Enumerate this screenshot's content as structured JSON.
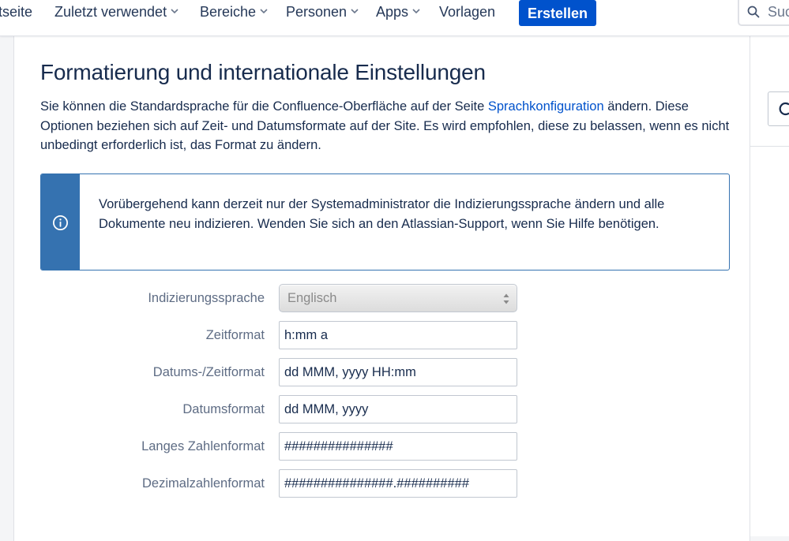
{
  "nav": {
    "items": [
      {
        "label": "tseite",
        "has_dropdown": false
      },
      {
        "label": "Zuletzt verwendet",
        "has_dropdown": true
      },
      {
        "label": "Bereiche",
        "has_dropdown": true
      },
      {
        "label": "Personen",
        "has_dropdown": true
      },
      {
        "label": "Apps",
        "has_dropdown": true
      },
      {
        "label": "Vorlagen",
        "has_dropdown": false
      }
    ],
    "create_label": "Erstellen",
    "search_placeholder": "Suchen",
    "accent_color": "#0052cc"
  },
  "page": {
    "title": "Formatierung und internationale Einstellungen",
    "description_before_link": "Sie können die Standardsprache für die Confluence-Oberfläche auf der Seite ",
    "description_link": "Sprachkonfiguration",
    "description_after_link": " ändern. Diese Optionen beziehen sich auf Zeit- und Datumsformate auf der Site. Es wird empfohlen, diese zu belassen, wenn es nicht unbedingt erforderlich ist, das Format zu ändern."
  },
  "info": {
    "icon": "info-icon",
    "text": "Vorübergehend kann derzeit nur der Systemadministrator die Indizierungssprache ändern und alle Dokumente neu indizieren. Wenden Sie sich an den Atlassian-Support, wenn Sie Hilfe benötigen.",
    "stripe_color": "#3572b0"
  },
  "form": {
    "indexing_language": {
      "label": "Indizierungssprache",
      "value": "Englisch",
      "disabled": true
    },
    "time_format": {
      "label": "Zeitformat",
      "value": "h:mm a"
    },
    "datetime_format": {
      "label": "Datums-/Zeitformat",
      "value": "dd MMM, yyyy HH:mm"
    },
    "date_format": {
      "label": "Datumsformat",
      "value": "dd MMM, yyyy"
    },
    "long_number_format": {
      "label": "Langes Zahlenformat",
      "value": "###############"
    },
    "decimal_number_format": {
      "label": "Dezimalzahlenformat",
      "value": "###############.##########"
    }
  }
}
